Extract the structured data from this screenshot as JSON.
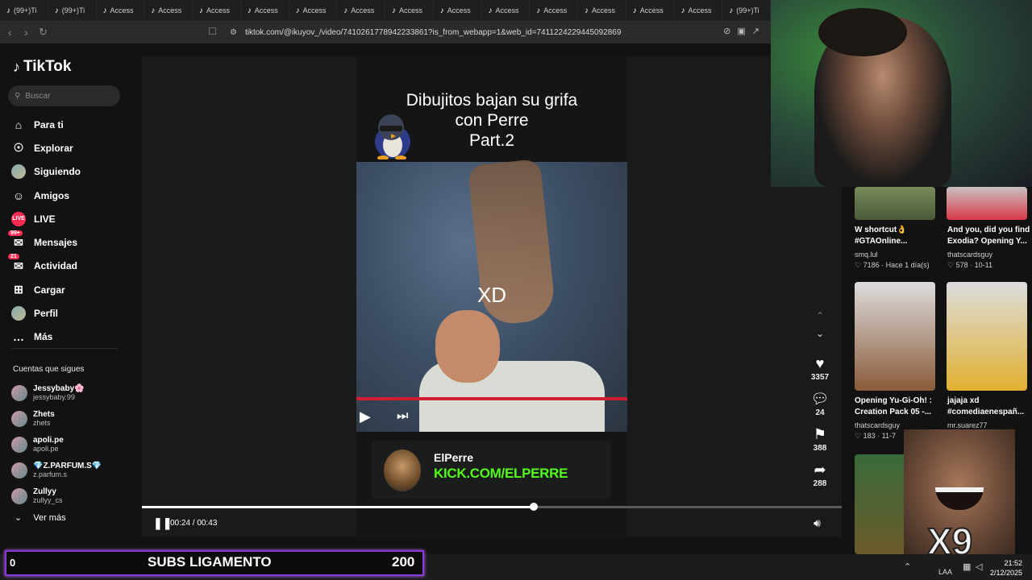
{
  "browser": {
    "tabs": [
      {
        "icon": "tiktok-icon",
        "label": "(99+)Ti"
      },
      {
        "icon": "tiktok-icon",
        "label": "(99+)Ti"
      },
      {
        "icon": "tiktok-icon",
        "label": "Access"
      },
      {
        "icon": "tiktok-icon",
        "label": "Access"
      },
      {
        "icon": "tiktok-icon",
        "label": "Access"
      },
      {
        "icon": "tiktok-icon",
        "label": "Access"
      },
      {
        "icon": "tiktok-icon",
        "label": "Access"
      },
      {
        "icon": "tiktok-icon",
        "label": "Access"
      },
      {
        "icon": "tiktok-icon",
        "label": "Access"
      },
      {
        "icon": "tiktok-icon",
        "label": "Access"
      },
      {
        "icon": "tiktok-icon",
        "label": "Access"
      },
      {
        "icon": "tiktok-icon",
        "label": "Access"
      },
      {
        "icon": "tiktok-icon",
        "label": "Access"
      },
      {
        "icon": "tiktok-icon",
        "label": "Access"
      },
      {
        "icon": "tiktok-icon",
        "label": "Access"
      },
      {
        "icon": "tiktok-icon",
        "label": "(99+)Ti"
      }
    ],
    "url": "tiktok.com/@ikuyov_/video/7410261778942233861?is_from_webapp=1&web_id=7411224229445092869"
  },
  "sidebar": {
    "logo": "TikTok",
    "search_placeholder": "Buscar",
    "nav": [
      {
        "label": "Para ti",
        "icon": "home-icon"
      },
      {
        "label": "Explorar",
        "icon": "compass-icon"
      },
      {
        "label": "Siguiendo",
        "icon": "following-avatar-icon"
      },
      {
        "label": "Amigos",
        "icon": "friends-icon"
      },
      {
        "label": "LIVE",
        "icon": "live-icon"
      },
      {
        "label": "Mensajes",
        "icon": "message-icon",
        "badge": "99+"
      },
      {
        "label": "Actividad",
        "icon": "activity-icon",
        "badge": "21"
      },
      {
        "label": "Cargar",
        "icon": "upload-icon"
      },
      {
        "label": "Perfil",
        "icon": "profile-avatar-icon"
      },
      {
        "label": "Más",
        "icon": "more-icon"
      }
    ],
    "following_title": "Cuentas que sigues",
    "following": [
      {
        "name": "Jessybaby🌸",
        "user": "jessybaby.99"
      },
      {
        "name": "Zhets",
        "user": "zhets"
      },
      {
        "name": "apoli.pe",
        "user": "apoli.pe"
      },
      {
        "name": "💎Z.PARFUM.S💎",
        "user": "z.parfum.s"
      },
      {
        "name": "Zullyy",
        "user": "zullyy_cs"
      }
    ],
    "ver_mas": "Ver más"
  },
  "video": {
    "title_lines": [
      "Dibujitos bajan su grifa",
      "con Perre",
      "Part.2"
    ],
    "caption": "XD",
    "kick_name": "ElPerre",
    "kick_url": "KICK.COM/ELPERRE",
    "time_current": "00:24",
    "time_total": "00:43",
    "progress": 0.56
  },
  "actions": {
    "likes": "3357",
    "comments": "24",
    "saves": "388",
    "shares": "288"
  },
  "recommended": [
    {
      "title": "W shortcut👌 #GTAOnline...",
      "user": "smq.lul",
      "likes": "7186",
      "age": "Hace 1 día(s)"
    },
    {
      "title": "And you, did you find Exodia? Opening Y...",
      "user": "thatscardsguy",
      "likes": "578",
      "age": "10-11"
    },
    {
      "title": "Opening Yu-Gi-Oh! : Creation Pack 05 -...",
      "user": "thatscardsguy",
      "likes": "183",
      "age": "11-7"
    },
    {
      "title": "jajaja xd #comediaenespañ...",
      "user": "mr.suarez77",
      "likes": "",
      "age": ""
    }
  ],
  "overlay": {
    "subs_label": "SUBS LIGAMENTO",
    "subs_count": "200",
    "subs_left": "0",
    "meme_text": "X9"
  },
  "taskbar": {
    "lang": "LAA",
    "time": "21:52",
    "date": "2/12/2025"
  },
  "colors": {
    "accent": "#fe2c55",
    "kick_green": "#53fc18",
    "subs_border": "#8a3ad8"
  }
}
